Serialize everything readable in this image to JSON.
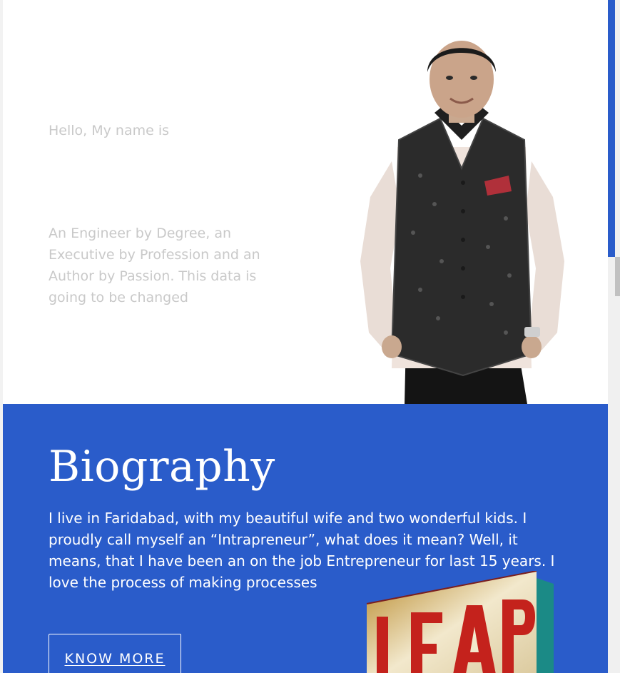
{
  "hero": {
    "greeting": "Hello, My name is",
    "tagline": "An Engineer by Degree, an Executive by Profession and an Author by Passion. This data is going to be changed"
  },
  "biography": {
    "title": "Biography",
    "text": "I live in Faridabad, with my beautiful wife and two wonderful kids. I proudly call myself an “Intrapreneur”, what does it mean? Well, it means, that I have been an on the job Entrepreneur for last 15 years. I love the process of making processes",
    "button_label": "KNOW MORE",
    "book_cover_text": "LEAP"
  },
  "colors": {
    "accent": "#2a5cca",
    "muted_text": "#c9c9c9",
    "book_red": "#c4221c"
  },
  "icons": {
    "portrait": "person-photo",
    "book": "book-cover"
  }
}
